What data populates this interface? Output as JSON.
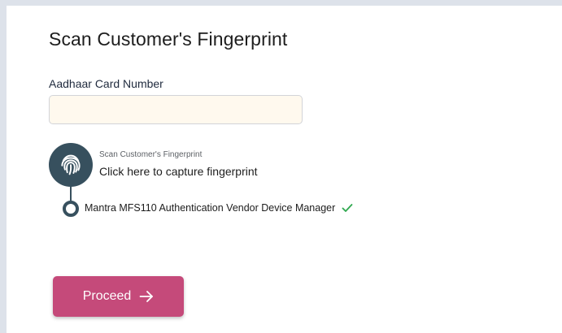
{
  "page": {
    "title": "Scan Customer's Fingerprint"
  },
  "aadhaar": {
    "label": "Aadhaar Card Number",
    "value": "",
    "placeholder": ""
  },
  "capture": {
    "caption": "Scan Customer's Fingerprint",
    "link_text": "Click here to capture fingerprint",
    "icon": "fingerprint-icon"
  },
  "device": {
    "name": "Mantra MFS110 Authentication Vendor Device Manager",
    "status_icon": "check-icon",
    "status_color": "#2fa84f"
  },
  "actions": {
    "proceed_label": "Proceed",
    "proceed_icon": "arrow-right-icon",
    "proceed_color": "#c54a7a"
  },
  "colors": {
    "accent_dark": "#37505e",
    "input_background": "#fff9ee"
  }
}
